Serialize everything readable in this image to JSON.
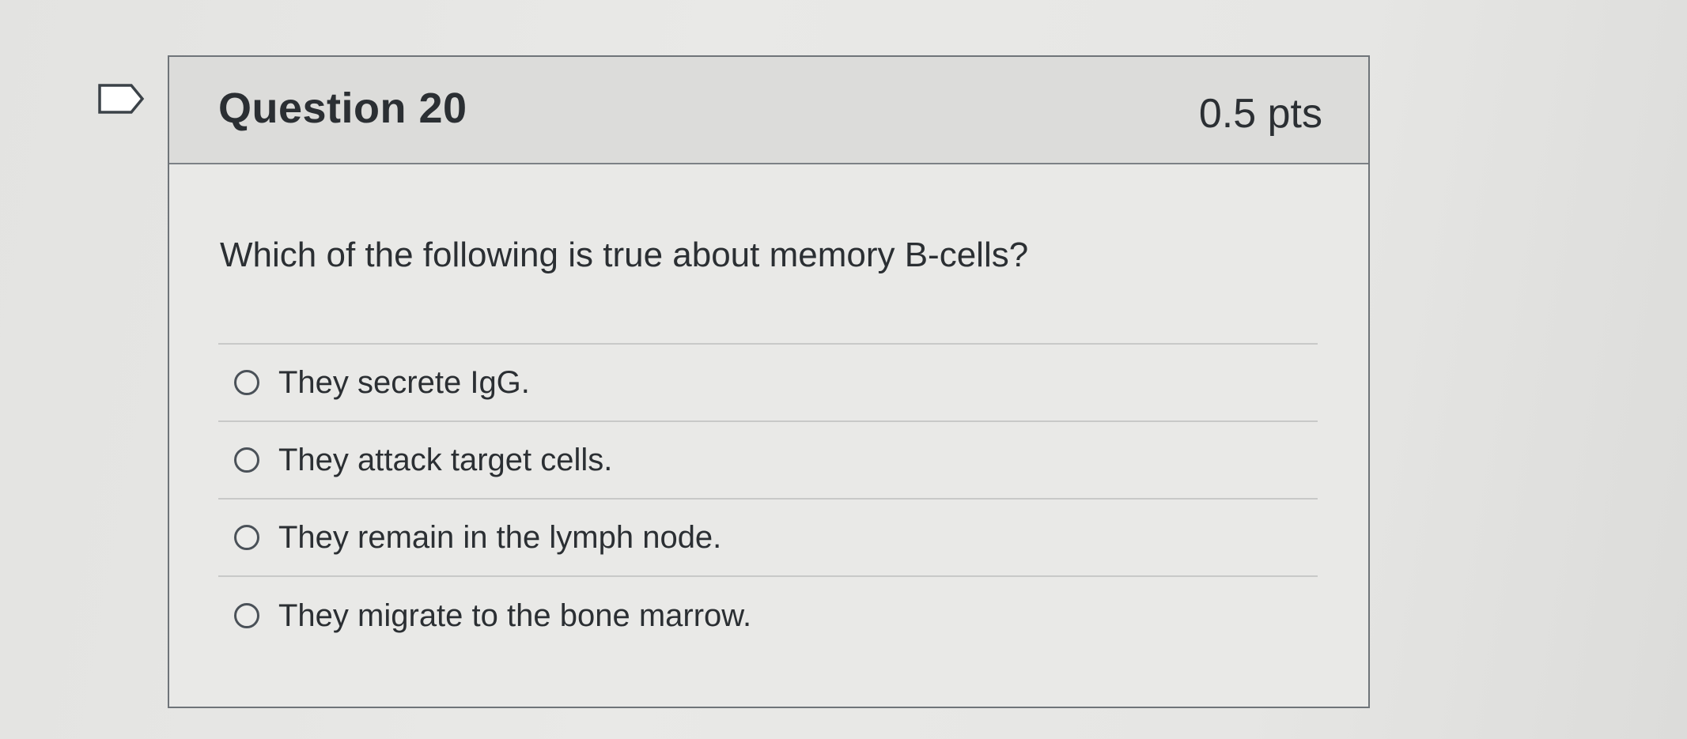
{
  "question": {
    "title": "Question 20",
    "points": "0.5 pts",
    "text": "Which of the following is true about memory B-cells?",
    "answers": [
      {
        "label": "They secrete IgG.",
        "selected": false
      },
      {
        "label": "They attack target cells.",
        "selected": false
      },
      {
        "label": "They remain in the lymph node.",
        "selected": false
      },
      {
        "label": "They migrate to the bone marrow.",
        "selected": false
      }
    ]
  },
  "icons": {
    "flag": "flag-outline-icon",
    "radio": "radio-unchecked-icon"
  },
  "colors": {
    "header_bg": "#dcdcda",
    "text": "#2b2f33",
    "border": "#6f7479"
  }
}
